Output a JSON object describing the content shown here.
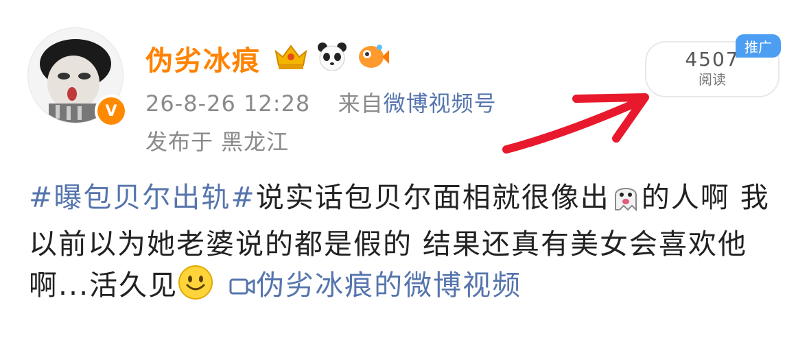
{
  "user": {
    "name": "伪劣冰痕",
    "verified_badge": "V",
    "badges": [
      "crown-icon",
      "panda-icon",
      "fish-icon"
    ]
  },
  "post": {
    "timestamp": "26-8-26 12:28",
    "source_prefix": "来自",
    "source": "微博视频号",
    "location": "发布于 黑龙江",
    "hashtag": "#曝包贝尔出轨#",
    "text_1": "说实话包贝尔面相就很像出",
    "text_2": "的人啊 我以前以为她老婆说的都是假的 结果还真有美女会喜欢他啊...活久见",
    "video_link": "伪劣冰痕的微博视频"
  },
  "stats": {
    "read_count": "4507",
    "read_label": "阅读",
    "promo_label": "推广"
  },
  "colors": {
    "username": "#ff8200",
    "link": "#5675ad",
    "promo": "#4c9ef2",
    "annotation_arrow": "#e8192c"
  }
}
